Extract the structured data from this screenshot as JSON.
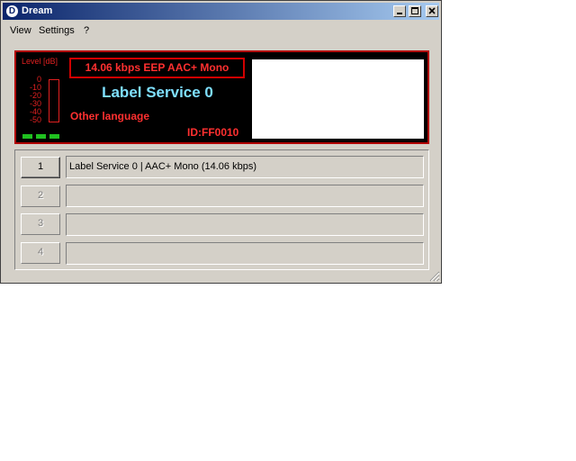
{
  "window": {
    "title": "Dream",
    "icon_letter": "D"
  },
  "menu": [
    "View",
    "Settings",
    "?"
  ],
  "display": {
    "level_label": "Level [dB]",
    "scale": [
      "0",
      "-10",
      "-20",
      "-30",
      "-40",
      "-50"
    ],
    "info": "14.06 kbps EEP  AAC+  Mono",
    "service_label": "Label Service 0",
    "language": "Other language",
    "id": "ID:FF0010"
  },
  "services": [
    {
      "button": "1",
      "text": "Label Service 0  |  AAC+ Mono (14.06 kbps)"
    },
    {
      "button": "2",
      "text": ""
    },
    {
      "button": "3",
      "text": ""
    },
    {
      "button": "4",
      "text": ""
    }
  ]
}
